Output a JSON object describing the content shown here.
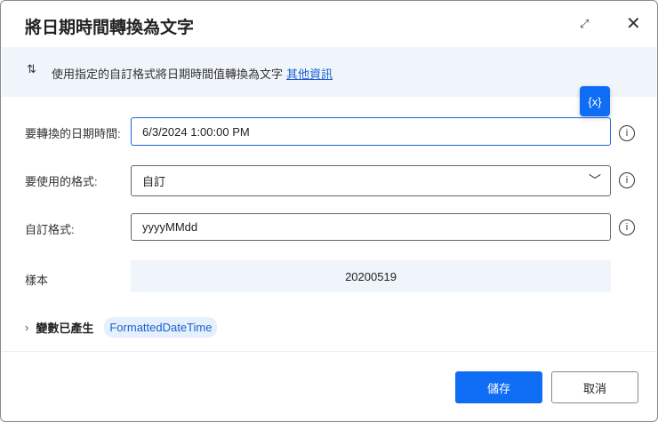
{
  "title": "將日期時間轉換為文字",
  "banner": {
    "description": "使用指定的自訂格式將日期時間值轉換為文字",
    "link": "其他資訊"
  },
  "var_button": "{x}",
  "fields": {
    "datetime": {
      "label": "要轉換的日期時間:",
      "value": "6/3/2024 1:00:00 PM"
    },
    "format": {
      "label": "要使用的格式:",
      "value": "自訂"
    },
    "custom": {
      "label": "自訂格式:",
      "value": "yyyyMMdd"
    },
    "sample": {
      "label": "樣本",
      "value": "20200519"
    }
  },
  "variables": {
    "label": "變數已產生",
    "name": "FormattedDateTime"
  },
  "buttons": {
    "save": "儲存",
    "cancel": "取消"
  },
  "icons": {
    "info": "i",
    "close": "✕",
    "expand": "⤢",
    "chevron": "﹀"
  }
}
